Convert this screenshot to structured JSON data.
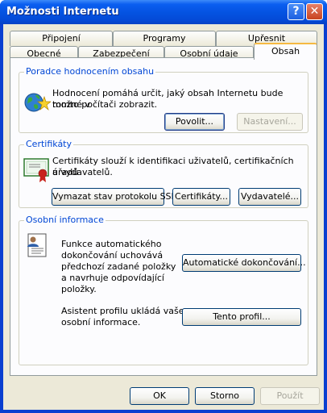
{
  "window": {
    "title": "Možnosti Internetu"
  },
  "tabs_back": [
    {
      "label": "Připojení"
    },
    {
      "label": "Programy"
    },
    {
      "label": "Upřesnit"
    }
  ],
  "tabs_front": [
    {
      "label": "Obecné"
    },
    {
      "label": "Zabezpečení"
    },
    {
      "label": "Osobní údaje"
    },
    {
      "label": "Obsah"
    }
  ],
  "ratings": {
    "title": "Poradce hodnocením obsahu",
    "line1": "Hodnocení pomáhá určit, jaký obsah Internetu bude možné v",
    "line2": "tomto počítači zobrazit.",
    "enable_label": "Povolit...",
    "settings_label": "Nastavení..."
  },
  "certificates": {
    "title": "Certifikáty",
    "line1": "Certifikáty slouží k identifikaci uživatelů, certifikačních úřadů",
    "line2": "a vydavatelů.",
    "clear_ssl_label": "Vymazat stav protokolu SSL",
    "certs_label": "Certifikáty...",
    "publishers_label": "Vydavatelé..."
  },
  "personal": {
    "title": "Osobní informace",
    "autocomplete_lines": [
      "Funkce automatického",
      "dokončování uchovává",
      "předchozí zadané položky",
      "a navrhuje odpovídající",
      "položky."
    ],
    "autocomplete_label": "Automatické dokončování...",
    "profile_lines": [
      "Asistent profilu ukládá vaše",
      "osobní informace."
    ],
    "profile_label": "Tento profil..."
  },
  "footer": {
    "ok_label": "OK",
    "cancel_label": "Storno",
    "apply_label": "Použít"
  },
  "icons": {
    "title_help": "?",
    "title_close": "✕"
  }
}
